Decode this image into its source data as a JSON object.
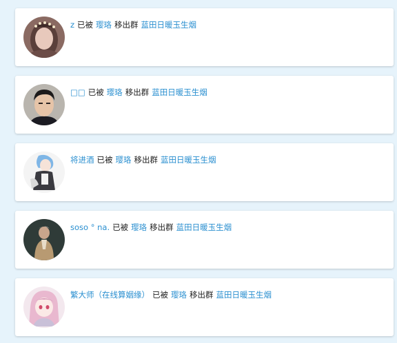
{
  "feed": {
    "items": [
      {
        "user": "z",
        "verb": "已被",
        "actor": "璎珞",
        "action": "移出群",
        "group": "蓝田日暖玉生烟",
        "avatar": "girl-portrait-avatar"
      },
      {
        "user": "□□",
        "verb": "已被",
        "actor": "璎珞",
        "action": "移出群",
        "group": "蓝田日暖玉生烟",
        "avatar": "man-portrait-avatar"
      },
      {
        "user": "将进酒",
        "verb": "已被",
        "actor": "璎珞",
        "action": "移出群",
        "group": "蓝田日暖玉生烟",
        "avatar": "anime-character-avatar"
      },
      {
        "user": "soso ° na.",
        "verb": "已被",
        "actor": "璎珞",
        "action": "移出群",
        "group": "蓝田日暖玉生烟",
        "avatar": "dark-portrait-avatar"
      },
      {
        "user": "繁大师（在线算姻缘）",
        "verb": "已被",
        "actor": "璎珞",
        "action": "移出群",
        "group": "蓝田日暖玉生烟",
        "avatar": "anime-girl-avatar"
      }
    ]
  },
  "colors": {
    "background": "#e6f3fb",
    "card": "#ffffff",
    "link": "#2a8fd0",
    "text": "#222222"
  }
}
